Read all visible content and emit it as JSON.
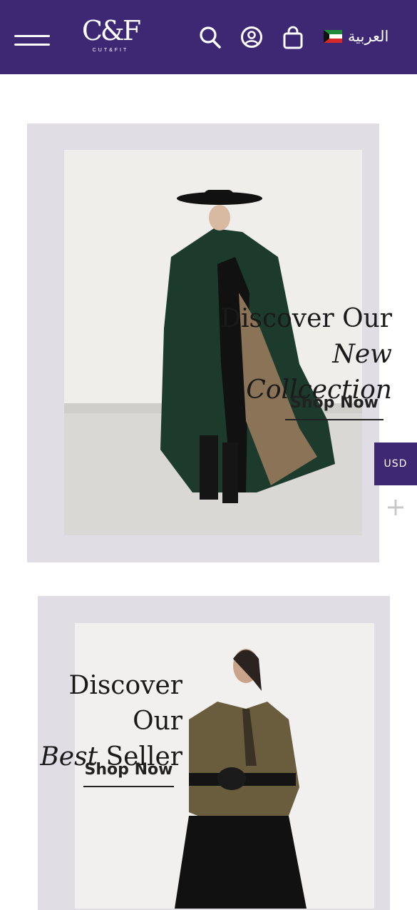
{
  "header": {
    "logo_mark": "C&F",
    "logo_tagline": "CUT&FIT",
    "icons": [
      "menu-icon",
      "search-icon",
      "account-icon",
      "shopping-bag-icon",
      "kuwait-flag-icon"
    ],
    "language_label": "العربية",
    "background_color": "#3f2873"
  },
  "banners": [
    {
      "heading_line1": "Discover Our",
      "heading_line2_accent": "New",
      "heading_line2_rest": "Collcection",
      "cta_label": "Shop Now"
    },
    {
      "heading_line1": "Discover Our",
      "heading_line2_accent": "Best",
      "heading_line2_rest": "Seller",
      "cta_label": "Shop Now"
    }
  ],
  "currency": {
    "label": "USD",
    "icon": "plus-icon"
  },
  "colors": {
    "brand_purple": "#3f2873",
    "banner_frame": "#e1dde4"
  }
}
